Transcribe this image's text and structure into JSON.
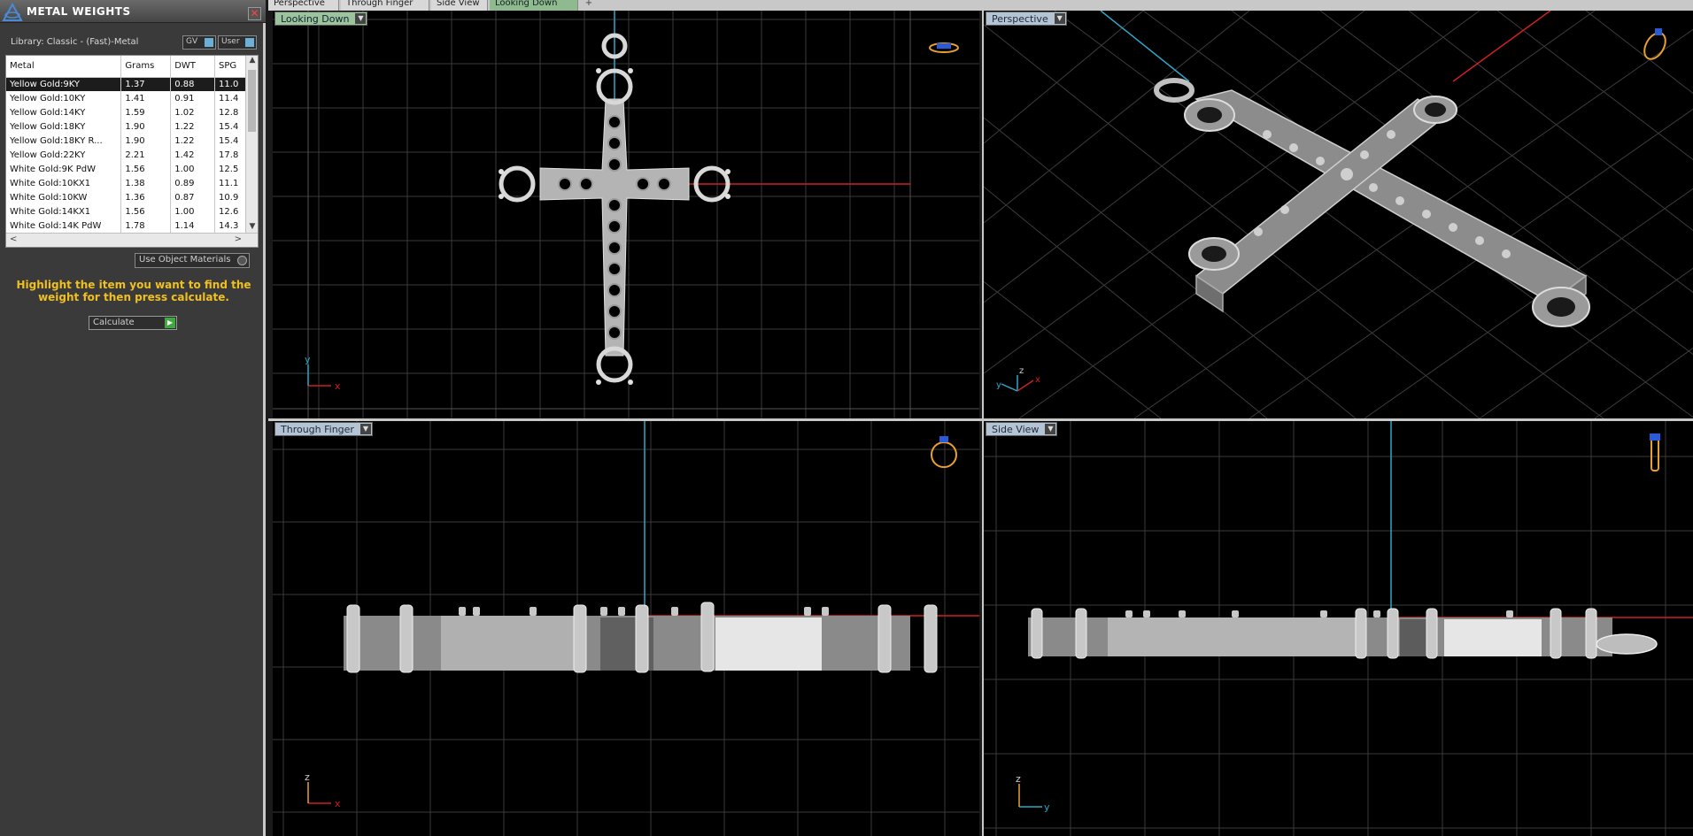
{
  "panel": {
    "title": "METAL WEIGHTS",
    "library_label": "Library: Classic - (Fast)-Metal",
    "gv_label": "GV",
    "user_label": "User",
    "use_object_materials": "Use Object Materials",
    "hint": "Highlight the item you want to find the weight for then press calculate.",
    "calculate_label": "Calculate",
    "table": {
      "headers": [
        "Metal",
        "Grams",
        "DWT",
        "SPG"
      ],
      "rows": [
        [
          "Yellow Gold:9KY",
          "1.37",
          "0.88",
          "11.0"
        ],
        [
          "Yellow Gold:10KY",
          "1.41",
          "0.91",
          "11.4"
        ],
        [
          "Yellow Gold:14KY",
          "1.59",
          "1.02",
          "12.8"
        ],
        [
          "Yellow Gold:18KY",
          "1.90",
          "1.22",
          "15.4"
        ],
        [
          "Yellow Gold:18KY R...",
          "1.90",
          "1.22",
          "15.4"
        ],
        [
          "Yellow Gold:22KY",
          "2.21",
          "1.42",
          "17.8"
        ],
        [
          "White Gold:9K PdW",
          "1.56",
          "1.00",
          "12.5"
        ],
        [
          "White Gold:10KX1",
          "1.38",
          "0.89",
          "11.1"
        ],
        [
          "White Gold:10KW",
          "1.36",
          "0.87",
          "10.9"
        ],
        [
          "White Gold:14KX1",
          "1.56",
          "1.00",
          "12.6"
        ],
        [
          "White Gold:14K PdW",
          "1.78",
          "1.14",
          "14.3"
        ]
      ],
      "selected_row": 0
    }
  },
  "tabs": [
    "Perspective",
    "Through Finger",
    "Side View",
    "Looking Down"
  ],
  "active_tab": "Looking Down",
  "viewports": {
    "top": "Looking Down",
    "perspective": "Perspective",
    "front": "Through Finger",
    "side": "Side View"
  },
  "axes": {
    "top": [
      "y",
      "x"
    ],
    "perspective": [
      "y",
      "z",
      "x"
    ],
    "front": [
      "z",
      "x"
    ],
    "side": [
      "z",
      "y"
    ]
  },
  "colors": {
    "accent_hint": "#f0c020",
    "axis_x": "#d02020",
    "axis_y": "#2aa8c8",
    "grid": "#3a3a3a",
    "metal": "#a8a8a8"
  }
}
